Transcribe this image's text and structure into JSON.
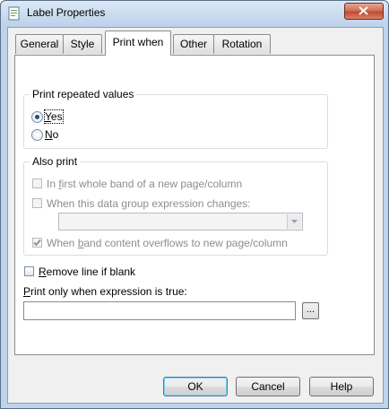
{
  "window": {
    "title": "Label Properties"
  },
  "tabs": [
    {
      "label": "General"
    },
    {
      "label": "Style"
    },
    {
      "label": "Print when"
    },
    {
      "label": "Other"
    },
    {
      "label": "Rotation"
    }
  ],
  "print_repeated": {
    "legend": "Print repeated values",
    "options": [
      {
        "pre": "",
        "key": "Y",
        "post": "es",
        "selected": true
      },
      {
        "pre": "",
        "key": "N",
        "post": "o",
        "selected": false
      }
    ]
  },
  "also_print": {
    "legend": "Also print",
    "first_band": {
      "pre": "In ",
      "key": "f",
      "post": "irst whole band of a new page/column",
      "checked": false
    },
    "group_change": {
      "pre": "When this data ",
      "key": "g",
      "post": "roup expression changes:",
      "checked": false
    },
    "group_combo_value": "",
    "band_overflow": {
      "pre": "When ",
      "key": "b",
      "post": "and content overflows to new page/column",
      "checked": true
    }
  },
  "remove_line": {
    "pre": "",
    "key": "R",
    "post": "emove line if blank",
    "checked": false
  },
  "expression": {
    "label_key": "P",
    "label_rest": "rint only when expression is true:",
    "value": "",
    "browse_label": "..."
  },
  "buttons": {
    "ok": "OK",
    "cancel": "Cancel",
    "help": "Help"
  }
}
